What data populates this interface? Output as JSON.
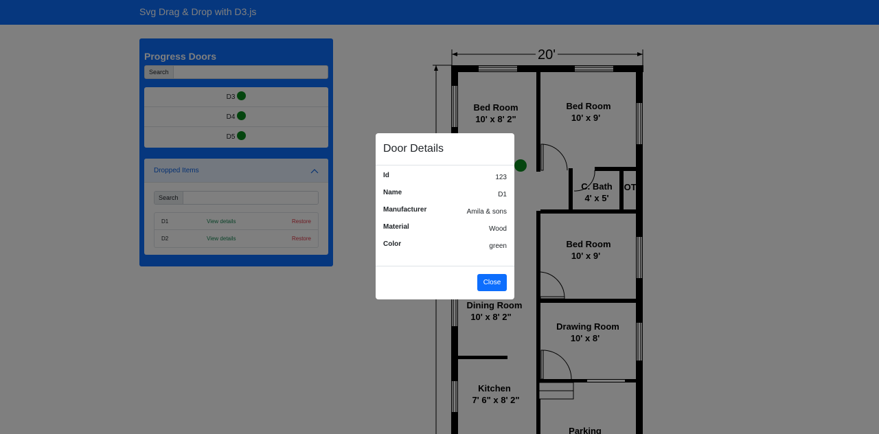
{
  "navbar": {
    "title": "Svg Drag & Drop with D3.js"
  },
  "sidebar": {
    "title": "Progress Doors",
    "search_label": "Search",
    "progress_items": [
      {
        "label": "D3",
        "status_color": "#0a8a1e"
      },
      {
        "label": "D4",
        "status_color": "#0a8a1e"
      },
      {
        "label": "D5",
        "status_color": "#0a8a1e"
      }
    ],
    "dropped": {
      "header": "Dropped Items",
      "search_label": "Search",
      "items": [
        {
          "name": "D1",
          "view_label": "View details",
          "restore_label": "Restore"
        },
        {
          "name": "D2",
          "view_label": "View details",
          "restore_label": "Restore"
        }
      ]
    }
  },
  "floorplan": {
    "width_label": "20'",
    "rooms": [
      {
        "name": "Bed Room",
        "size": "10' x 8' 2\""
      },
      {
        "name": "Bed Room",
        "size": "10' x 9'"
      },
      {
        "name": "C. Bath",
        "size": "4' x 5'"
      },
      {
        "name": "OTS",
        "size": ""
      },
      {
        "name": "Bed Room",
        "size": "10' x 9'"
      },
      {
        "name": "Dining Room",
        "size": "10' x 8' 2\""
      },
      {
        "name": "Drawing Room",
        "size": "10' x 8'"
      },
      {
        "name": "Kitchen",
        "size": "7' 6\" x 8' 2\""
      },
      {
        "name": "Parking",
        "size": ""
      }
    ],
    "marker_color": "#0a8a1e"
  },
  "modal": {
    "title": "Door Details",
    "fields": [
      {
        "label": "Id",
        "value": "123"
      },
      {
        "label": "Name",
        "value": "D1"
      },
      {
        "label": "Manufacturer",
        "value": "Amila & sons"
      },
      {
        "label": "Material",
        "value": "Wood"
      },
      {
        "label": "Color",
        "value": "green"
      }
    ],
    "close_label": "Close"
  },
  "colors": {
    "primary": "#0d6efd",
    "success": "#198754",
    "danger": "#dc3545",
    "door_marker": "#0a8a1e"
  }
}
